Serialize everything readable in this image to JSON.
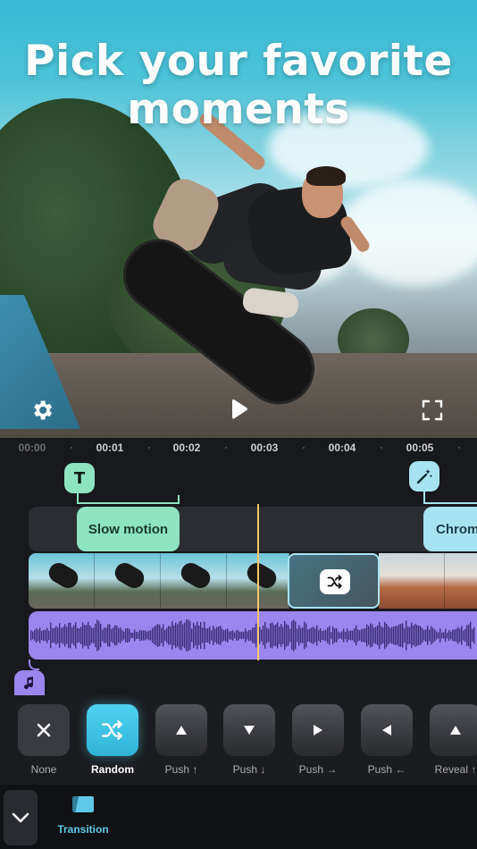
{
  "headline": {
    "line1": "Pick your favorite",
    "line2": "moments"
  },
  "player": {
    "settings_icon": "gear-icon",
    "play_icon": "play-icon",
    "fullscreen_icon": "fullscreen-icon"
  },
  "timeline": {
    "ticks": [
      "00:00",
      "00:01",
      "00:02",
      "00:03",
      "00:04",
      "00:05"
    ],
    "text_tag": "T",
    "clips": {
      "slow_motion": "Slow motion",
      "chroma": "Chrom"
    }
  },
  "transitions": [
    {
      "label": "None",
      "icon": "close-icon"
    },
    {
      "label": "Random",
      "icon": "shuffle-icon"
    },
    {
      "label": "Push ↑",
      "icon": "arrow-up-icon"
    },
    {
      "label": "Push ↓",
      "icon": "arrow-down-icon"
    },
    {
      "label": "Push →",
      "icon": "arrow-right-icon"
    },
    {
      "label": "Push ←",
      "icon": "arrow-left-icon"
    },
    {
      "label": "Reveal ↑",
      "icon": "arrow-up-icon"
    }
  ],
  "selected_transition": "Random",
  "bottom_bar": {
    "collapse_icon": "chevron-down-icon",
    "tool_label": "Transition",
    "tool_icon": "transition-icon"
  },
  "colors": {
    "accent": "#4fd2ee",
    "slow_motion": "#8ee3c1",
    "chroma": "#a8e3f2",
    "audio": "#9b86f0",
    "playhead": "#f4c86a"
  }
}
